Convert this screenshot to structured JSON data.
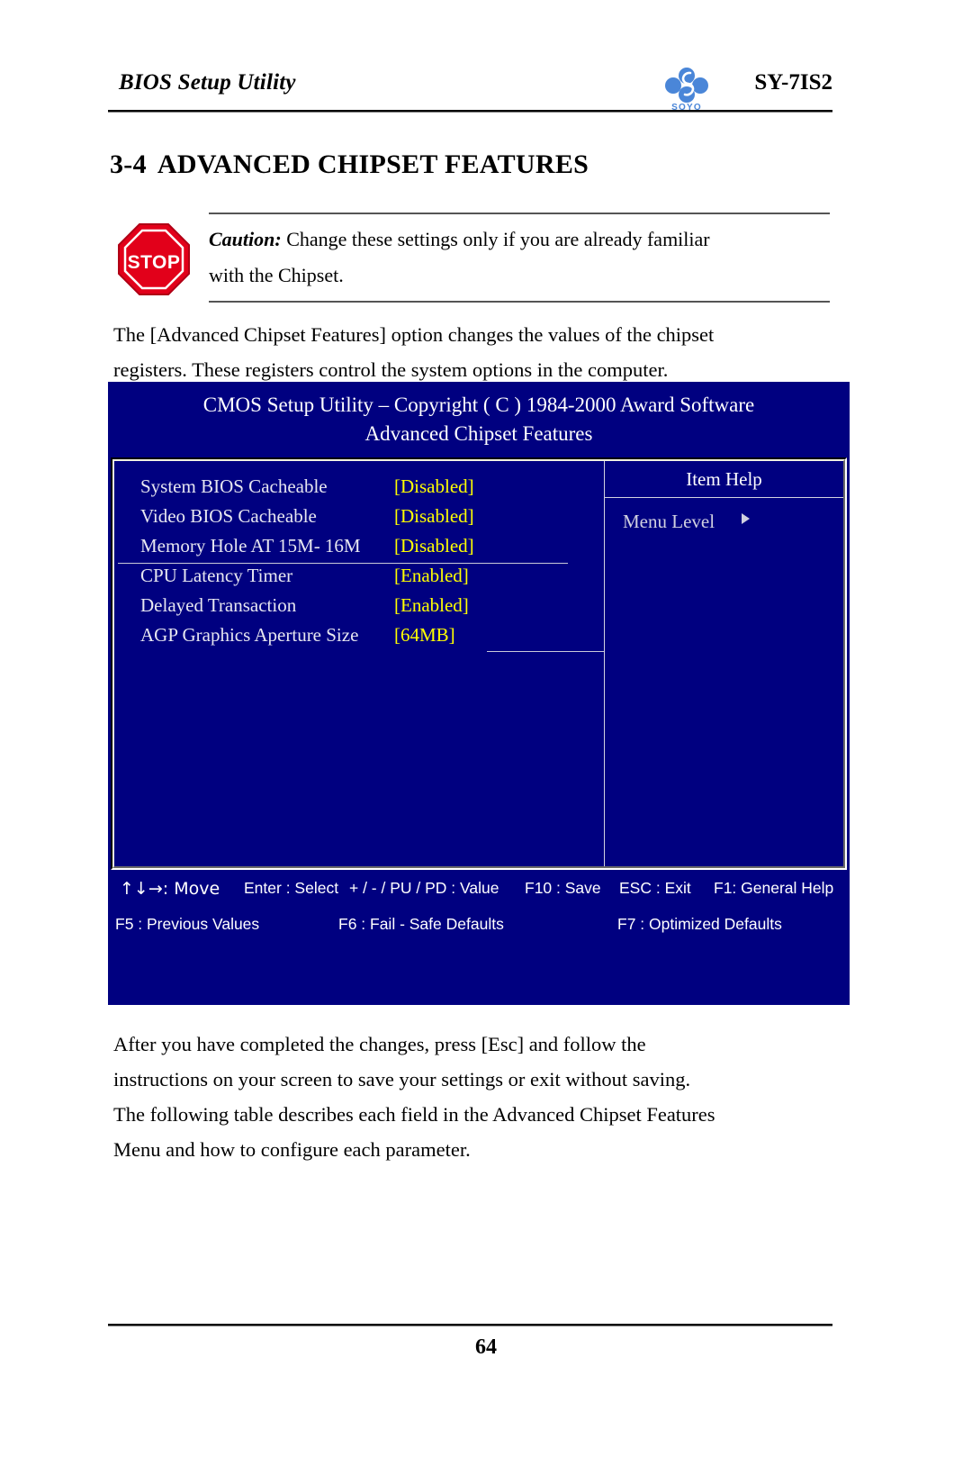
{
  "header": {
    "title": "BIOS Setup Utility",
    "model": "SY-7IS2",
    "logo_text": "SOYO"
  },
  "section": {
    "number": "3-4",
    "title": "ADVANCED CHIPSET FEATURES"
  },
  "caution": {
    "label": "Caution:",
    "line1_rest": " Change these settings only if you are already familiar",
    "line2": "with the Chipset.",
    "icon_text": "STOP"
  },
  "intro_paragraph": [
    "The [Advanced Chipset Features] option changes the values of the chipset",
    "registers. These registers control the system options in the computer."
  ],
  "bios": {
    "title_line1": "CMOS Setup Utility – Copyright ( C ) 1984-2000 Award Software",
    "title_line2": "Advanced Chipset Features",
    "settings": [
      {
        "name": "System BIOS Cacheable",
        "value": "[Disabled]"
      },
      {
        "name": "Video BIOS Cacheable",
        "value": "[Disabled]"
      },
      {
        "name": "Memory Hole AT 15M- 16M",
        "value": "[Disabled]"
      },
      {
        "name": "CPU Latency Timer",
        "value": "[Enabled]"
      },
      {
        "name": "Delayed Transaction",
        "value": "[Enabled]"
      },
      {
        "name": "AGP Graphics Aperture Size",
        "value": "[64MB]"
      }
    ],
    "help": {
      "title": "Item Help",
      "menu_level_label": "Menu Level"
    },
    "keys_row1": [
      {
        "label": "↑↓→: Move"
      },
      {
        "label": "Enter : Select"
      },
      {
        "label": "+ / - / PU / PD : Value"
      },
      {
        "label": "F10 : Save"
      },
      {
        "label": "ESC : Exit"
      },
      {
        "label": "F1: General Help"
      }
    ],
    "keys_row2": [
      {
        "label": "F5 : Previous Values"
      },
      {
        "label": "F6 : Fail - Safe Defaults"
      },
      {
        "label": "F7 : Optimized Defaults"
      }
    ],
    "colors": {
      "background": "#000080",
      "value_text": "#ffff00",
      "label_text": "#e6e6f0"
    }
  },
  "outro_paragraph": [
    "After you have completed the changes, press [Esc] and follow the",
    "instructions on your screen to save your settings or exit without saving.",
    "The following table describes each field in the Advanced Chipset Features",
    "Menu and how to configure each parameter."
  ],
  "footer": {
    "page_number": "64"
  }
}
